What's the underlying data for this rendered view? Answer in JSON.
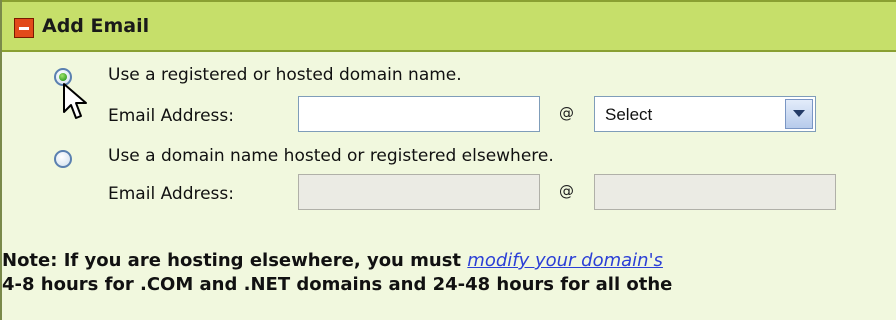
{
  "section": {
    "title": "Add Email"
  },
  "options": [
    {
      "label": "Use a registered or hosted domain name.",
      "checked": true,
      "email_label": "Email Address:",
      "email_value": "",
      "at": "@",
      "domain_select_value": "Select"
    },
    {
      "label": "Use a domain name hosted or registered elsewhere.",
      "checked": false,
      "email_label": "Email Address:",
      "email_value": "",
      "at": "@",
      "domain_value": ""
    }
  ],
  "note": {
    "line1_prefix": "Note: If you are hosting elsewhere, you must ",
    "line1_link": "modify your domain's",
    "line2": "4-8 hours for .COM and .NET domains and 24-48 hours for all othe"
  },
  "colors": {
    "header_bg": "#c6df6a",
    "panel_bg": "#f1f8de",
    "link": "#2b3fd6",
    "collapse_icon": "#e24a1a"
  },
  "icons": {
    "collapse": "minus-square-icon",
    "select_arrow": "chevron-down-icon",
    "cursor": "mouse-pointer-icon"
  }
}
